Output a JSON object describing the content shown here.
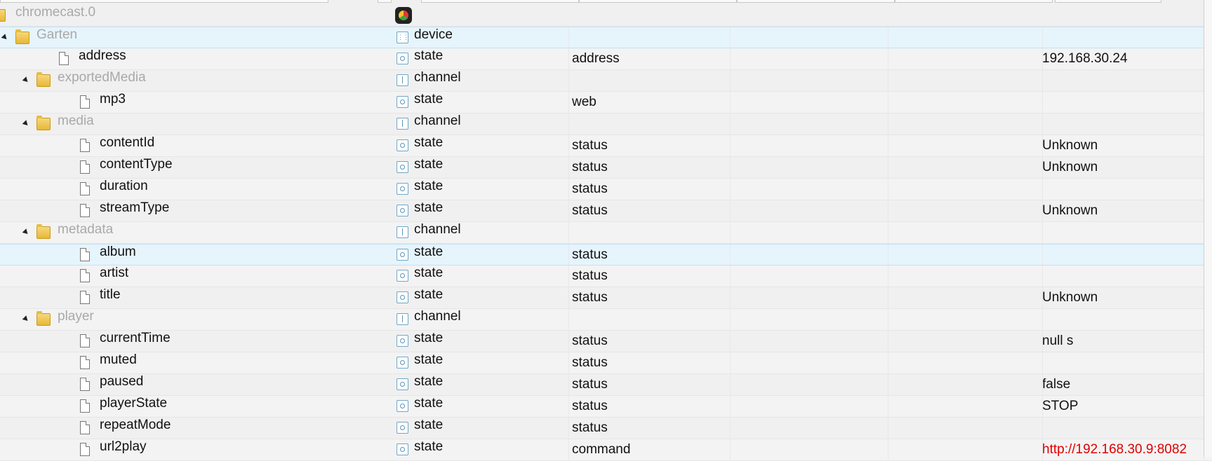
{
  "root": {
    "name": "chromecast.0"
  },
  "rows": [
    {
      "name": "Garten",
      "kind": "folder",
      "level": 1,
      "type": "device",
      "role": "",
      "value": ""
    },
    {
      "name": "address",
      "kind": "file",
      "level": 2,
      "type": "state",
      "role": "address",
      "value": "192.168.30.24"
    },
    {
      "name": "exportedMedia",
      "kind": "folder",
      "level": 2,
      "type": "channel",
      "role": "",
      "value": ""
    },
    {
      "name": "mp3",
      "kind": "file",
      "level": 3,
      "type": "state",
      "role": "web",
      "value": ""
    },
    {
      "name": "media",
      "kind": "folder",
      "level": 2,
      "type": "channel",
      "role": "",
      "value": ""
    },
    {
      "name": "contentId",
      "kind": "file",
      "level": 3,
      "type": "state",
      "role": "status",
      "value": "Unknown"
    },
    {
      "name": "contentType",
      "kind": "file",
      "level": 3,
      "type": "state",
      "role": "status",
      "value": "Unknown"
    },
    {
      "name": "duration",
      "kind": "file",
      "level": 3,
      "type": "state",
      "role": "status",
      "value": ""
    },
    {
      "name": "streamType",
      "kind": "file",
      "level": 3,
      "type": "state",
      "role": "status",
      "value": "Unknown"
    },
    {
      "name": "metadata",
      "kind": "folder",
      "level": 2,
      "type": "channel",
      "role": "",
      "value": ""
    },
    {
      "name": "album",
      "kind": "file",
      "level": 3,
      "type": "state",
      "role": "status",
      "value": ""
    },
    {
      "name": "artist",
      "kind": "file",
      "level": 3,
      "type": "state",
      "role": "status",
      "value": ""
    },
    {
      "name": "title",
      "kind": "file",
      "level": 3,
      "type": "state",
      "role": "status",
      "value": "Unknown"
    },
    {
      "name": "player",
      "kind": "folder",
      "level": 2,
      "type": "channel",
      "role": "",
      "value": ""
    },
    {
      "name": "currentTime",
      "kind": "file",
      "level": 3,
      "type": "state",
      "role": "status",
      "value": "null s"
    },
    {
      "name": "muted",
      "kind": "file",
      "level": 3,
      "type": "state",
      "role": "status",
      "value": ""
    },
    {
      "name": "paused",
      "kind": "file",
      "level": 3,
      "type": "state",
      "role": "status",
      "value": "false"
    },
    {
      "name": "playerState",
      "kind": "file",
      "level": 3,
      "type": "state",
      "role": "status",
      "value": "STOP"
    },
    {
      "name": "repeatMode",
      "kind": "file",
      "level": 3,
      "type": "state",
      "role": "status",
      "value": ""
    },
    {
      "name": "url2play",
      "kind": "file",
      "level": 3,
      "type": "state",
      "role": "command",
      "value": "http://192.168.30.9:8082"
    }
  ],
  "colors": {
    "selected_row": "#e6f4fc",
    "value_link": "#e00000",
    "folder_label": "#a9a9a9"
  },
  "icons": {
    "folder": "folder-icon",
    "file": "file-icon",
    "state": "state-icon",
    "channel": "channel-icon",
    "device": "device-icon",
    "adapter": "chromecast-icon"
  }
}
